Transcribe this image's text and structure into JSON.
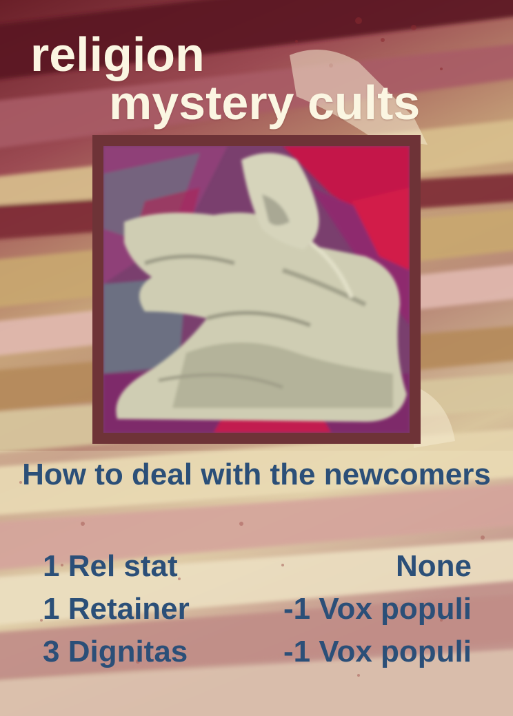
{
  "card": {
    "title_line_1": "religion",
    "title_line_2": "mystery cults",
    "heading": "How to deal with the newcomers",
    "options": [
      {
        "cost": "1 Rel stat",
        "effect": "None"
      },
      {
        "cost": "1 Retainer",
        "effect": "-1 Vox populi"
      },
      {
        "cost": "3 Dignitas",
        "effect": "-1 Vox populi"
      }
    ]
  },
  "colors": {
    "title_text": "#fbf6e2",
    "body_text": "#2b4f78",
    "frame": "#6e3337",
    "background_dark": "#7a2a32",
    "background_gold": "#c9b07a"
  },
  "art": {
    "subject": "pale hooded cloaked figure on crimson and violet brushstrokes"
  }
}
